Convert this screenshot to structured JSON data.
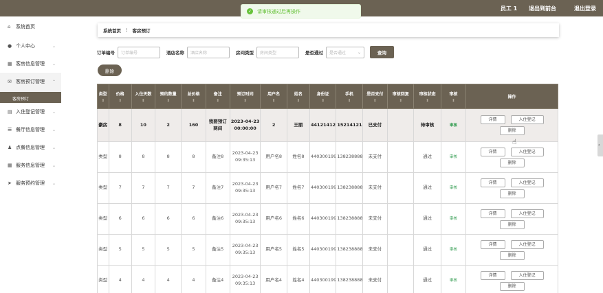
{
  "topbar": {
    "nav": [
      "员工 1",
      "退出到前台"
    ],
    "logout": "退出登录"
  },
  "toast": {
    "message": "请审核通过后再操作"
  },
  "sidebar": {
    "items": [
      {
        "label": "系统首页",
        "icon": "home-icon",
        "glyph": "⌂"
      },
      {
        "label": "个人中心",
        "icon": "user-icon",
        "glyph": "●"
      },
      {
        "label": "客房信息管理",
        "icon": "grid-icon",
        "glyph": "▦"
      },
      {
        "label": "客房预订管理",
        "icon": "mail-icon",
        "glyph": "✉"
      },
      {
        "label": "入住登记管理",
        "icon": "doc-icon",
        "glyph": "▤"
      },
      {
        "label": "餐厅信息管理",
        "icon": "list-icon",
        "glyph": "☰"
      },
      {
        "label": "点餐信息管理",
        "icon": "person-icon",
        "glyph": "♟"
      },
      {
        "label": "服务信息管理",
        "icon": "grid-icon",
        "glyph": "▦"
      },
      {
        "label": "服务预约管理",
        "icon": "send-icon",
        "glyph": "➤"
      }
    ],
    "sub_item": "客房预订"
  },
  "breadcrumb": {
    "home": "系统首页",
    "sep": "⋮",
    "current": "客房预订"
  },
  "search": {
    "order_label": "订单编号",
    "order_placeholder": "订单编号",
    "hotel_label": "酒店名称",
    "hotel_placeholder": "酒店名称",
    "room_label": "房间类型",
    "room_placeholder": "房间类型",
    "pass_label": "是否通过",
    "pass_placeholder": "是否通过",
    "query_btn": "查询"
  },
  "delete_btn": "删除",
  "table": {
    "headers": [
      "类型",
      "价格",
      "入住天数",
      "预约数量",
      "总价格",
      "备注",
      "预订时间",
      "用户名",
      "姓名",
      "身份证",
      "手机",
      "是否支付",
      "审核回复",
      "审核状态",
      "审核",
      "操作"
    ],
    "sortable": [
      true,
      true,
      true,
      true,
      true,
      true,
      true,
      true,
      true,
      true,
      true,
      true,
      true,
      true,
      true,
      false
    ],
    "rows": [
      {
        "type": "豪房",
        "price": "8",
        "days": "10",
        "count": "2",
        "total": "160",
        "note": "我要预订两间",
        "time": "2023-04-23 00:00:00",
        "user": "2",
        "name": "王丽",
        "id": "441214121412141211",
        "phone": "15214121411",
        "paid": "已支付",
        "reply": "",
        "status": "待审核",
        "audit": "审核"
      },
      {
        "type": "类型",
        "price": "8",
        "days": "8",
        "count": "8",
        "total": "8",
        "note": "备注8",
        "time": "2023-04-23 09:35:13",
        "user": "用户名8",
        "name": "姓名8",
        "id": "440300199808080008",
        "phone": "13823888888",
        "paid": "未支付",
        "reply": "",
        "status": "通过",
        "audit": "审核"
      },
      {
        "type": "类型",
        "price": "7",
        "days": "7",
        "count": "7",
        "total": "7",
        "note": "备注7",
        "time": "2023-04-23 09:35:13",
        "user": "用户名7",
        "name": "姓名7",
        "id": "440300199707070007",
        "phone": "13823888887",
        "paid": "未支付",
        "reply": "",
        "status": "通过",
        "audit": "审核"
      },
      {
        "type": "类型",
        "price": "6",
        "days": "6",
        "count": "6",
        "total": "6",
        "note": "备注6",
        "time": "2023-04-23 09:35:13",
        "user": "用户名6",
        "name": "姓名6",
        "id": "440300199606060006",
        "phone": "13823888886",
        "paid": "未支付",
        "reply": "",
        "status": "通过",
        "audit": "审核"
      },
      {
        "type": "类型",
        "price": "5",
        "days": "5",
        "count": "5",
        "total": "5",
        "note": "备注5",
        "time": "2023-04-23 09:35:13",
        "user": "用户名5",
        "name": "姓名5",
        "id": "440300199505050005",
        "phone": "13823888885",
        "paid": "未支付",
        "reply": "",
        "status": "通过",
        "audit": "审核"
      },
      {
        "type": "类型",
        "price": "4",
        "days": "4",
        "count": "4",
        "total": "4",
        "note": "备注4",
        "time": "2023-04-23 09:35:13",
        "user": "用户名4",
        "name": "姓名4",
        "id": "440300199404040004",
        "phone": "13823888884",
        "paid": "未支付",
        "reply": "",
        "status": "通过",
        "audit": "审核"
      }
    ],
    "ops": {
      "detail": "详情",
      "checkin": "入住登记",
      "delete": "删除"
    },
    "sort_glyph": "⇕"
  },
  "colors": {
    "brand": "#6b6253",
    "success": "#67c23a",
    "audit_link": "#2e9a4d"
  }
}
